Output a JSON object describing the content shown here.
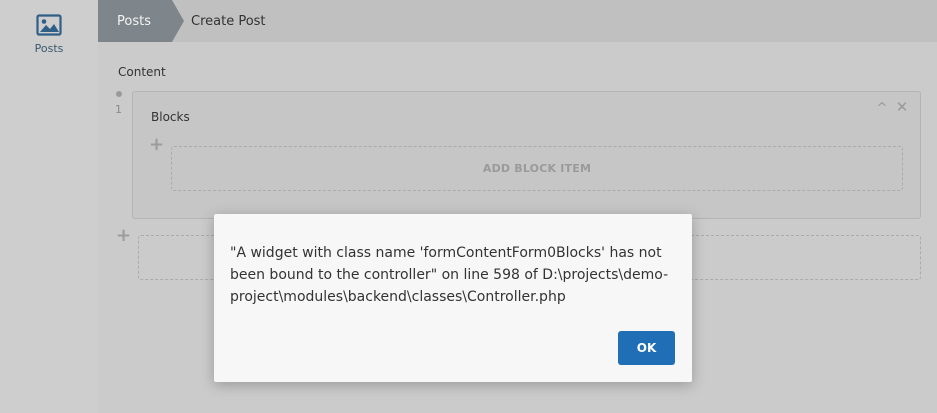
{
  "sidebar": {
    "items": [
      {
        "label": "Posts",
        "icon": "image-icon"
      }
    ]
  },
  "breadcrumb": {
    "parent": "Posts",
    "current": "Create Post"
  },
  "form": {
    "content_label": "Content",
    "repeater_index": "1",
    "blocks_label": "Blocks",
    "add_block_label": "ADD BLOCK ITEM"
  },
  "modal": {
    "message": "\"A widget with class name 'formContentForm0Blocks' has not been bound to the controller\" on line 598 of D:\\projects\\demo-project\\modules\\backend\\classes\\Controller.php",
    "ok_label": "OK"
  },
  "colors": {
    "accent": "#1f6eb6",
    "breadcrumb_active": "#7e868c"
  }
}
